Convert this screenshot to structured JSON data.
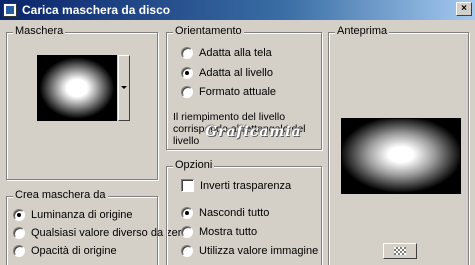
{
  "window": {
    "title": "Carica maschera da disco",
    "close_label": "×"
  },
  "maschera": {
    "label": "Maschera"
  },
  "orientamento": {
    "label": "Orientamento",
    "options": [
      "Adatta alla tela",
      "Adatta al livello",
      "Formato attuale"
    ],
    "selected": "Adatta al livello",
    "info": "Il riempimento del livello corrisponde al rettangolo del livello"
  },
  "anteprima": {
    "label": "Anteprima"
  },
  "watermark": {
    "text": "Graficamia"
  },
  "opzioni": {
    "label": "Opzioni",
    "invert_label": "Inverti trasparenza",
    "invert_checked": false,
    "options": [
      "Nascondi tutto",
      "Mostra tutto",
      "Utilizza valore immagine"
    ],
    "selected": "Nascondi tutto"
  },
  "crea": {
    "label": "Crea maschera da",
    "options": [
      "Luminanza di origine",
      "Qualsiasi valore diverso da zero",
      "Opacità di origine"
    ],
    "selected": "Luminanza di origine"
  }
}
